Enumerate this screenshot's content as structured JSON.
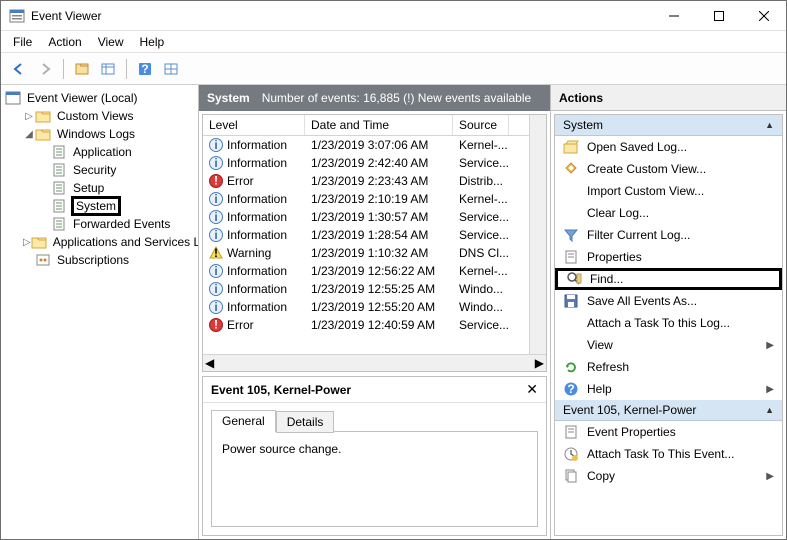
{
  "window": {
    "title": "Event Viewer"
  },
  "menubar": [
    "File",
    "Action",
    "View",
    "Help"
  ],
  "tree": {
    "root": "Event Viewer (Local)",
    "items": [
      {
        "label": "Custom Views",
        "indent": 1,
        "expander": "▷",
        "icon": "folder"
      },
      {
        "label": "Windows Logs",
        "indent": 1,
        "expander": "◢",
        "icon": "folder"
      },
      {
        "label": "Application",
        "indent": 2,
        "expander": "",
        "icon": "log"
      },
      {
        "label": "Security",
        "indent": 2,
        "expander": "",
        "icon": "log"
      },
      {
        "label": "Setup",
        "indent": 2,
        "expander": "",
        "icon": "log"
      },
      {
        "label": "System",
        "indent": 2,
        "expander": "",
        "icon": "log",
        "highlight": true
      },
      {
        "label": "Forwarded Events",
        "indent": 2,
        "expander": "",
        "icon": "log"
      },
      {
        "label": "Applications and Services Lo",
        "indent": 1,
        "expander": "▷",
        "icon": "folder"
      },
      {
        "label": "Subscriptions",
        "indent": 1,
        "expander": "",
        "icon": "subs"
      }
    ]
  },
  "center": {
    "header_log": "System",
    "header_count": "Number of events: 16,885 (!) New events available",
    "columns": {
      "level": "Level",
      "date": "Date and Time",
      "source": "Source"
    },
    "rows": [
      {
        "icon": "info",
        "level": "Information",
        "date": "1/23/2019 3:07:06 AM",
        "source": "Kernel-..."
      },
      {
        "icon": "info",
        "level": "Information",
        "date": "1/23/2019 2:42:40 AM",
        "source": "Service..."
      },
      {
        "icon": "error",
        "level": "Error",
        "date": "1/23/2019 2:23:43 AM",
        "source": "Distrib..."
      },
      {
        "icon": "info",
        "level": "Information",
        "date": "1/23/2019 2:10:19 AM",
        "source": "Kernel-..."
      },
      {
        "icon": "info",
        "level": "Information",
        "date": "1/23/2019 1:30:57 AM",
        "source": "Service..."
      },
      {
        "icon": "info",
        "level": "Information",
        "date": "1/23/2019 1:28:54 AM",
        "source": "Service..."
      },
      {
        "icon": "warn",
        "level": "Warning",
        "date": "1/23/2019 1:10:32 AM",
        "source": "DNS Cl..."
      },
      {
        "icon": "info",
        "level": "Information",
        "date": "1/23/2019 12:56:22 AM",
        "source": "Kernel-..."
      },
      {
        "icon": "info",
        "level": "Information",
        "date": "1/23/2019 12:55:25 AM",
        "source": "Windo..."
      },
      {
        "icon": "info",
        "level": "Information",
        "date": "1/23/2019 12:55:20 AM",
        "source": "Windo..."
      },
      {
        "icon": "error",
        "level": "Error",
        "date": "1/23/2019 12:40:59 AM",
        "source": "Service..."
      }
    ]
  },
  "detail": {
    "title": "Event 105, Kernel-Power",
    "tab_general": "General",
    "tab_details": "Details",
    "body": "Power source change."
  },
  "actions": {
    "title": "Actions",
    "sections": [
      {
        "label": "System",
        "items": [
          {
            "icon": "open",
            "label": "Open Saved Log..."
          },
          {
            "icon": "create",
            "label": "Create Custom View..."
          },
          {
            "icon": "blank",
            "label": "Import Custom View..."
          },
          {
            "icon": "blank",
            "label": "Clear Log..."
          },
          {
            "icon": "filter",
            "label": "Filter Current Log..."
          },
          {
            "icon": "props",
            "label": "Properties"
          },
          {
            "icon": "find",
            "label": "Find...",
            "highlight": true
          },
          {
            "icon": "save",
            "label": "Save All Events As..."
          },
          {
            "icon": "blank",
            "label": "Attach a Task To this Log..."
          },
          {
            "icon": "blank",
            "label": "View",
            "submenu": true
          },
          {
            "icon": "refresh",
            "label": "Refresh"
          },
          {
            "icon": "help",
            "label": "Help",
            "submenu": true
          }
        ]
      },
      {
        "label": "Event 105, Kernel-Power",
        "items": [
          {
            "icon": "props",
            "label": "Event Properties"
          },
          {
            "icon": "attach",
            "label": "Attach Task To This Event..."
          },
          {
            "icon": "copy",
            "label": "Copy",
            "submenu": true
          }
        ]
      }
    ]
  }
}
